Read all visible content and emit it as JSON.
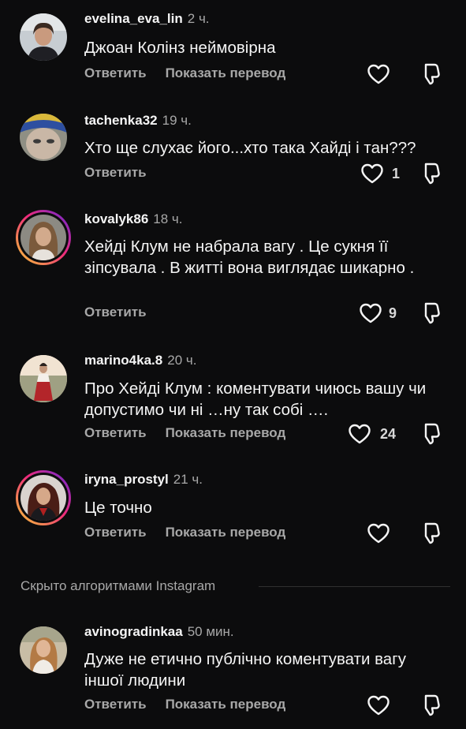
{
  "comments": [
    {
      "username": "evelina_eva_lin",
      "time": "2 ч.",
      "text": "Джоан Колінз неймовірна",
      "reply_label": "Ответить",
      "translate_label": "Показать перевод",
      "like_count": ""
    },
    {
      "username": "tachenka32",
      "time": "19 ч.",
      "text": "Хто ще слухає його...хто така Хайді і тан???",
      "reply_label": "Ответить",
      "translate_label": "",
      "like_count": "1"
    },
    {
      "username": "kovalyk86",
      "time": "18 ч.",
      "text": "Хейді Клум не набрала вагу . Це сукня її зіпсувала . В житті вона виглядає шикарно .",
      "reply_label": "Ответить",
      "translate_label": "",
      "like_count": "9"
    },
    {
      "username": "marino4ka.8",
      "time": "20 ч.",
      "text": "Про Хейді Клум : коментувати чиюсь вашу чи допустимо чи ні …ну так собі ….",
      "reply_label": "Ответить",
      "translate_label": "Показать перевод",
      "like_count": "24"
    },
    {
      "username": "iryna_prostyl",
      "time": "21 ч.",
      "text": "Це точно",
      "reply_label": "Ответить",
      "translate_label": "Показать перевод",
      "like_count": ""
    },
    {
      "username": "avinogradinkaa",
      "time": "50 мин.",
      "text": "Дуже не етично публічно коментувати вагу іншої людини",
      "reply_label": "Ответить",
      "translate_label": "Показать перевод",
      "like_count": ""
    }
  ],
  "hidden_section": {
    "label": "Скрыто алгоритмами Instagram"
  },
  "icons": {
    "like": "heart-outline-icon",
    "dislike": "thumbs-down-outline-icon"
  },
  "colors": {
    "background": "#0c0c0d",
    "text_primary": "#f5f5f5",
    "text_secondary": "#a8a8a8",
    "story_ring_start": "#f9ce34",
    "story_ring_mid": "#ee2a7b",
    "story_ring_end": "#6228d7"
  }
}
